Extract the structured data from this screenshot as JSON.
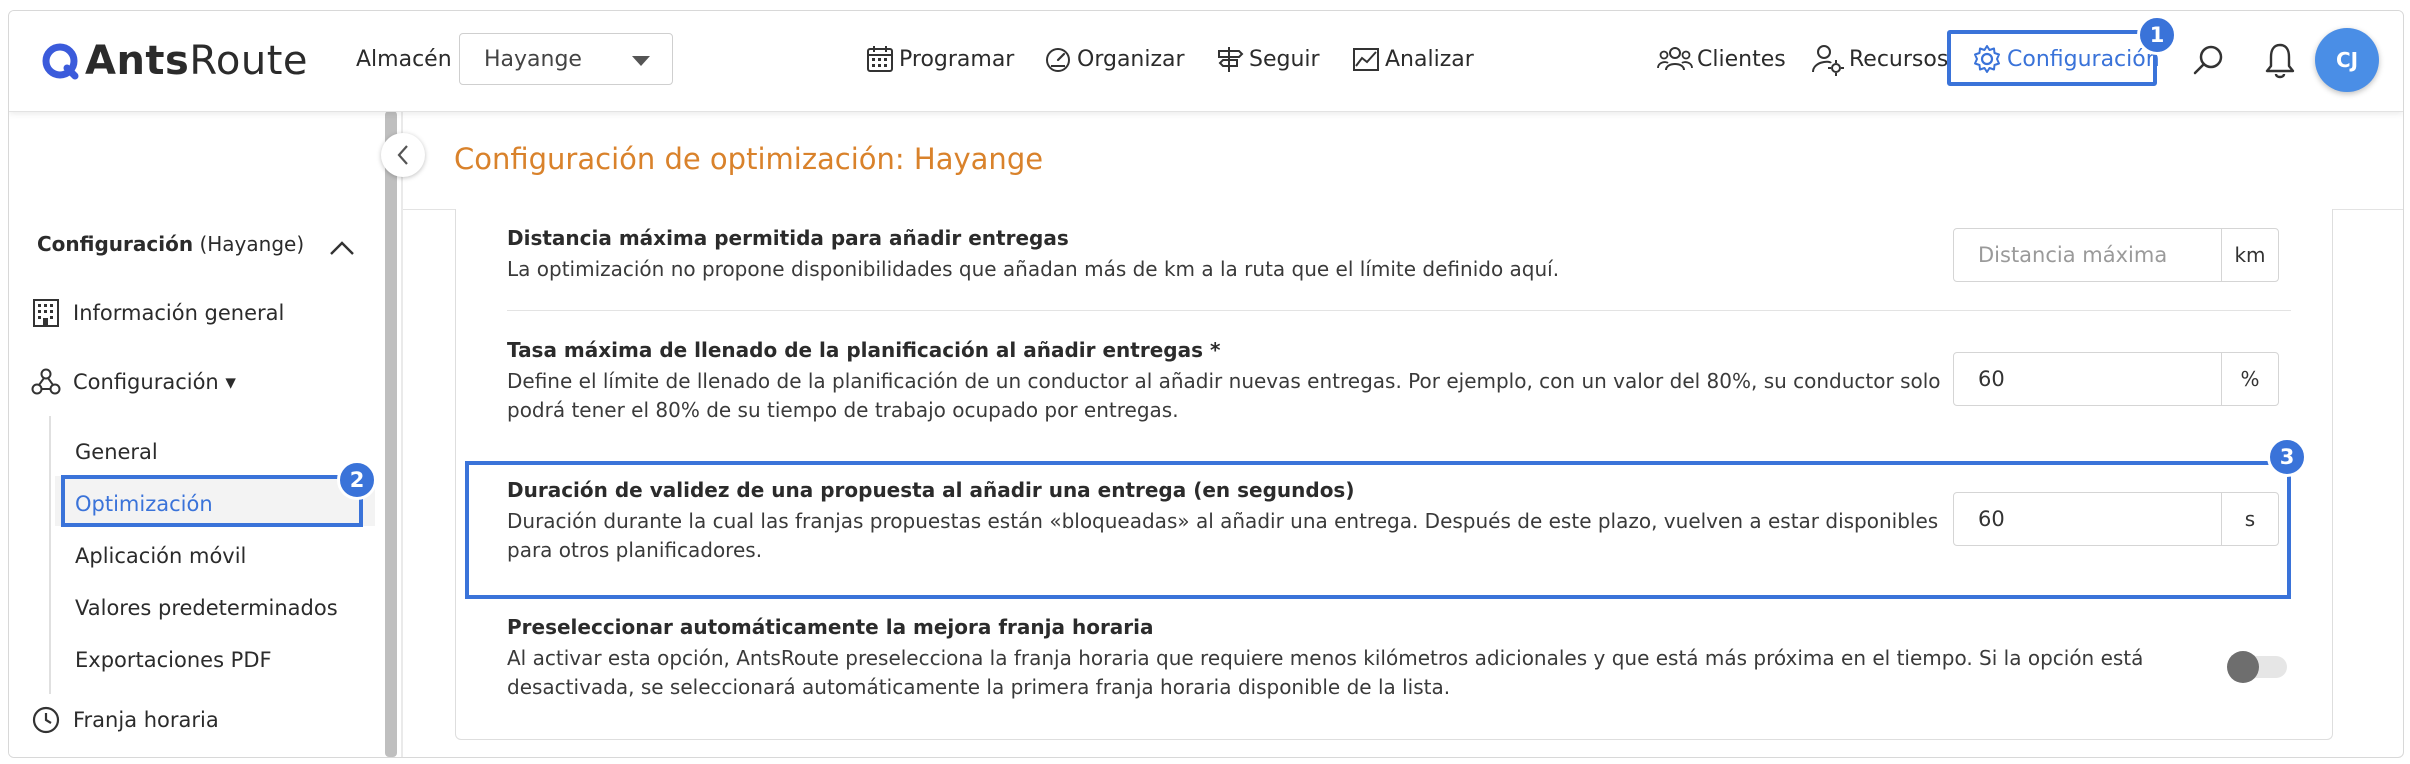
{
  "app": {
    "name_bold": "Ants",
    "name_light": "Route"
  },
  "header": {
    "warehouse_label": "Almacén",
    "warehouse_value": "Hayange",
    "nav": [
      {
        "label": "Programar",
        "icon": "calendar-icon"
      },
      {
        "label": "Organizar",
        "icon": "gauge-icon"
      },
      {
        "label": "Seguir",
        "icon": "signpost-icon"
      },
      {
        "label": "Analizar",
        "icon": "chart-icon"
      }
    ],
    "right_nav": [
      {
        "label": "Clientes",
        "icon": "clients-icon"
      },
      {
        "label": "Recursos",
        "icon": "resources-icon"
      },
      {
        "label": "Configuración",
        "icon": "gear-icon"
      }
    ],
    "avatar_initials": "CJ"
  },
  "sidebar": {
    "section_title": "Configuración",
    "section_scope": "(Hayange)",
    "items": [
      {
        "label": "Información general",
        "icon": "building-icon"
      },
      {
        "label": "Configuración ▾",
        "icon": "config-nodes-icon"
      }
    ],
    "subitems": [
      "General",
      "Optimización",
      "Aplicación móvil",
      "Valores predeterminados",
      "Exportaciones PDF"
    ],
    "bottom_item": {
      "label": "Franja horaria",
      "icon": "clock-icon"
    }
  },
  "main": {
    "title": "Configuración de optimización: Hayange",
    "settings": [
      {
        "title": "Distancia máxima permitida para añadir entregas",
        "desc_lines": [
          "La optimización no propone disponibilidades que añadan más de km a la ruta que el límite definido aquí."
        ],
        "placeholder": "Distancia máxima",
        "unit": "km"
      },
      {
        "title": "Tasa máxima de llenado de la planificación al añadir entregas *",
        "desc_lines": [
          "Define el límite de llenado de la planificación de un conductor al añadir nuevas entregas. Por ejemplo, con un valor del 80%, su conductor solo",
          "podrá tener el 80% de su tiempo de trabajo ocupado por entregas."
        ],
        "value": "60",
        "unit": "%"
      },
      {
        "title": "Duración de validez de una propuesta al añadir una entrega (en segundos)",
        "desc_lines": [
          "Duración durante la cual las franjas propuestas están «bloqueadas» al añadir una entrega. Después de este plazo, vuelven a estar disponibles",
          "para otros planificadores."
        ],
        "value": "60",
        "unit": "s"
      },
      {
        "title": "Preseleccionar automáticamente la mejora franja horaria",
        "desc_lines": [
          "Al activar esta opción, AntsRoute preselecciona la franja horaria que requiere menos kilómetros adicionales y que está más próxima en el tiempo. Si la opción está",
          "desactivada, se seleccionará automáticamente la primera franja horaria disponible de la lista."
        ],
        "toggle_on": false
      }
    ]
  },
  "annotations": {
    "badge1": "1",
    "badge2": "2",
    "badge3": "3"
  },
  "colors": {
    "accent": "#3a73d9",
    "title_orange": "#d9822b",
    "avatar": "#4a8ee6"
  }
}
